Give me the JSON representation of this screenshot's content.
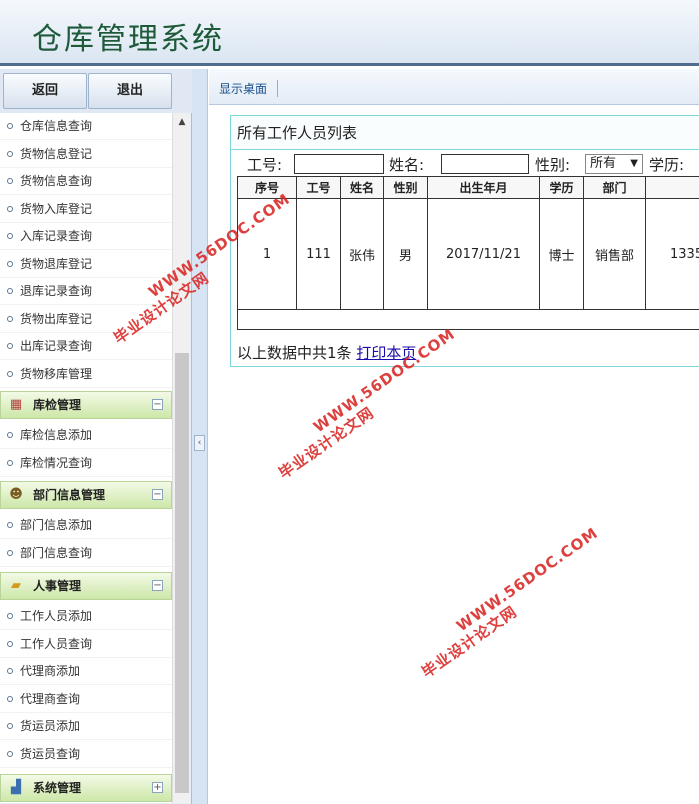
{
  "app": {
    "title": "仓库管理系统"
  },
  "sidebar": {
    "back_label": "返回",
    "exit_label": "退出",
    "items_top": [
      {
        "label": "仓库信息查询"
      },
      {
        "label": "货物信息登记"
      },
      {
        "label": "货物信息查询"
      },
      {
        "label": "货物入库登记"
      },
      {
        "label": "入库记录查询"
      },
      {
        "label": "货物退库登记"
      },
      {
        "label": "退库记录查询"
      },
      {
        "label": "货物出库登记"
      },
      {
        "label": "出库记录查询"
      },
      {
        "label": "货物移库管理"
      }
    ],
    "groups": [
      {
        "label": "库检管理",
        "icon": "calendar-icon",
        "toggle": "−",
        "items": [
          {
            "label": "库检信息添加"
          },
          {
            "label": "库检情况查询"
          }
        ]
      },
      {
        "label": "部门信息管理",
        "icon": "person-icon",
        "toggle": "−",
        "items": [
          {
            "label": "部门信息添加"
          },
          {
            "label": "部门信息查询"
          }
        ]
      },
      {
        "label": "人事管理",
        "icon": "folder-icon",
        "toggle": "−",
        "items": [
          {
            "label": "工作人员添加"
          },
          {
            "label": "工作人员查询"
          },
          {
            "label": "代理商添加"
          },
          {
            "label": "代理商查询"
          },
          {
            "label": "货运员添加"
          },
          {
            "label": "货运员查询"
          }
        ]
      },
      {
        "label": "系统管理",
        "icon": "chart-icon",
        "toggle": "+",
        "items": []
      }
    ]
  },
  "tabbar": {
    "tab_label": "显示桌面"
  },
  "panel": {
    "title": "所有工作人员列表",
    "filters": {
      "job_no_label": "工号:",
      "name_label": "姓名:",
      "gender_label": "性别:",
      "gender_value": "所有",
      "education_label": "学历:"
    },
    "columns": [
      "序号",
      "工号",
      "姓名",
      "性别",
      "出生年月",
      "学历",
      "部门",
      ""
    ],
    "rows": [
      [
        "1",
        "111",
        "张伟",
        "男",
        "2017/11/21",
        "博士",
        "销售部",
        "1335"
      ]
    ],
    "summary_prefix": "以上数据中共1条",
    "print_link": "打印本页"
  },
  "watermarks": [
    {
      "line1": "WWW.56DOC.COM",
      "line2": "毕业设计论文网"
    },
    {
      "line1": "WWW.56DOC.COM",
      "line2": "毕业设计论文网"
    },
    {
      "line1": "WWW.56DOC.COM",
      "line2": "毕业设计论文网"
    }
  ],
  "colors": {
    "accent_green": "#cde7a8",
    "header_border": "#4f6d8c",
    "panel_border": "#7cd6dc",
    "watermark": "#d8201e"
  }
}
